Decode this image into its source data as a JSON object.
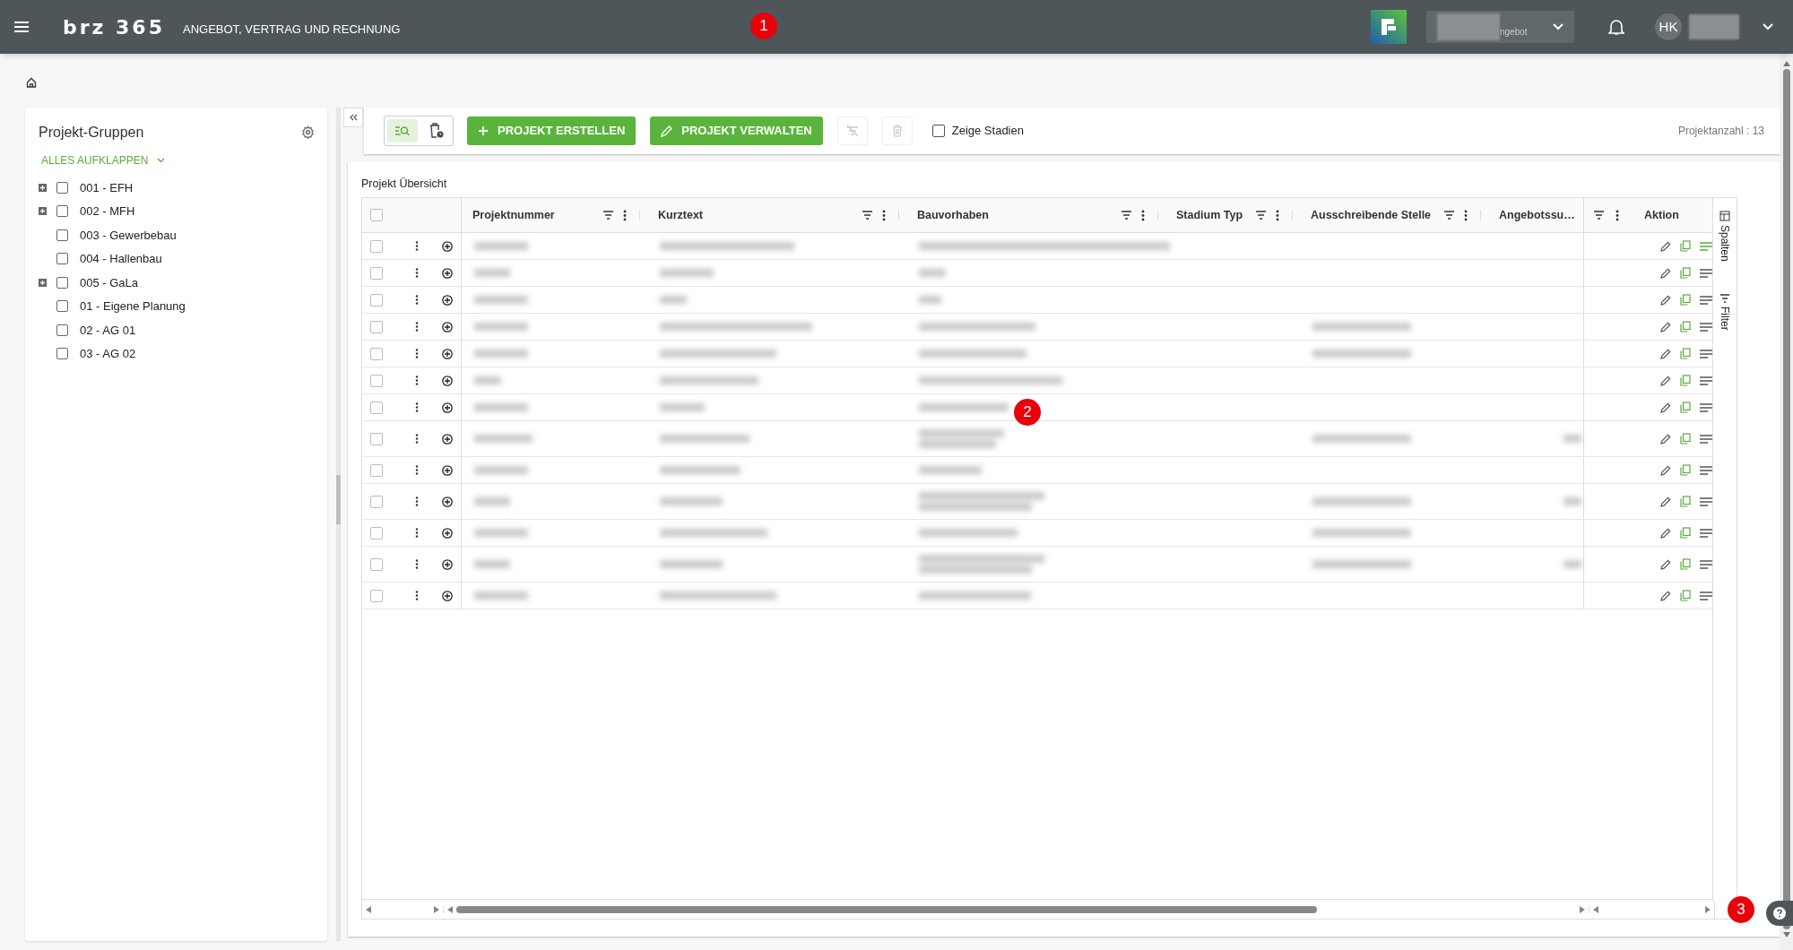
{
  "header": {
    "logo": "brz 365",
    "subtitle": "ANGEBOT, VERTRAG UND RECHNUNG",
    "module_dropdown": "ngebot",
    "avatar": "HK"
  },
  "callouts": [
    "1",
    "2",
    "3"
  ],
  "sidebar": {
    "title": "Projekt-Gruppen",
    "expand_all": "ALLES AUFKLAPPEN",
    "groups": [
      {
        "label": "001 - EFH",
        "expandable": true,
        "checked": false
      },
      {
        "label": "002 - MFH",
        "expandable": true,
        "checked": false
      },
      {
        "label": "003 - Gewerbebau",
        "expandable": false,
        "checked": false
      },
      {
        "label": "004 - Hallenbau",
        "expandable": false,
        "checked": false
      },
      {
        "label": "005 - GaLa",
        "expandable": true,
        "checked": false
      },
      {
        "label": "01 - Eigene Planung",
        "expandable": false,
        "checked": false
      },
      {
        "label": "02 - AG 01",
        "expandable": false,
        "checked": false
      },
      {
        "label": "03 - AG 02",
        "expandable": false,
        "checked": false
      }
    ]
  },
  "toolbar": {
    "views": [
      {
        "kind": "list-search",
        "selected": true
      },
      {
        "kind": "trash-clock",
        "selected": false
      }
    ],
    "create": "PROJEKT ERSTELLEN",
    "manage": "PROJEKT VERWALTEN",
    "show_stages": {
      "label": "Zeige Stadien",
      "checked": false
    },
    "count": "Projektanzahl : 13"
  },
  "table": {
    "title": "Projekt Übersicht",
    "select_all_checked": false,
    "columns": [
      "Projektnummer",
      "Kurztext",
      "Bauvorhaben",
      "Stadium Typ",
      "Ausschreibende Stelle",
      "Angebotssu…"
    ],
    "action_column": "Aktion",
    "side_tabs": [
      "Spalten",
      "Filter"
    ],
    "rows": [
      {
        "checked": false,
        "tall": false,
        "stelle_filled": false,
        "summe_filled": false,
        "notes_active": true
      },
      {
        "checked": false,
        "tall": false,
        "stelle_filled": false,
        "summe_filled": false,
        "notes_active": false
      },
      {
        "checked": false,
        "tall": false,
        "stelle_filled": false,
        "summe_filled": false,
        "notes_active": false
      },
      {
        "checked": false,
        "tall": false,
        "stelle_filled": true,
        "summe_filled": false,
        "notes_active": false
      },
      {
        "checked": false,
        "tall": false,
        "stelle_filled": true,
        "summe_filled": false,
        "notes_active": false
      },
      {
        "checked": false,
        "tall": false,
        "stelle_filled": false,
        "summe_filled": false,
        "notes_active": false
      },
      {
        "checked": false,
        "tall": false,
        "stelle_filled": false,
        "summe_filled": false,
        "notes_active": false
      },
      {
        "checked": false,
        "tall": true,
        "stelle_filled": true,
        "summe_filled": true,
        "notes_active": false
      },
      {
        "checked": false,
        "tall": false,
        "stelle_filled": false,
        "summe_filled": false,
        "notes_active": false
      },
      {
        "checked": false,
        "tall": true,
        "stelle_filled": true,
        "summe_filled": true,
        "notes_active": false
      },
      {
        "checked": false,
        "tall": false,
        "stelle_filled": true,
        "summe_filled": false,
        "notes_active": false
      },
      {
        "checked": false,
        "tall": true,
        "stelle_filled": true,
        "summe_filled": true,
        "notes_active": false
      },
      {
        "checked": false,
        "tall": false,
        "stelle_filled": false,
        "summe_filled": false,
        "notes_active": false
      }
    ]
  }
}
